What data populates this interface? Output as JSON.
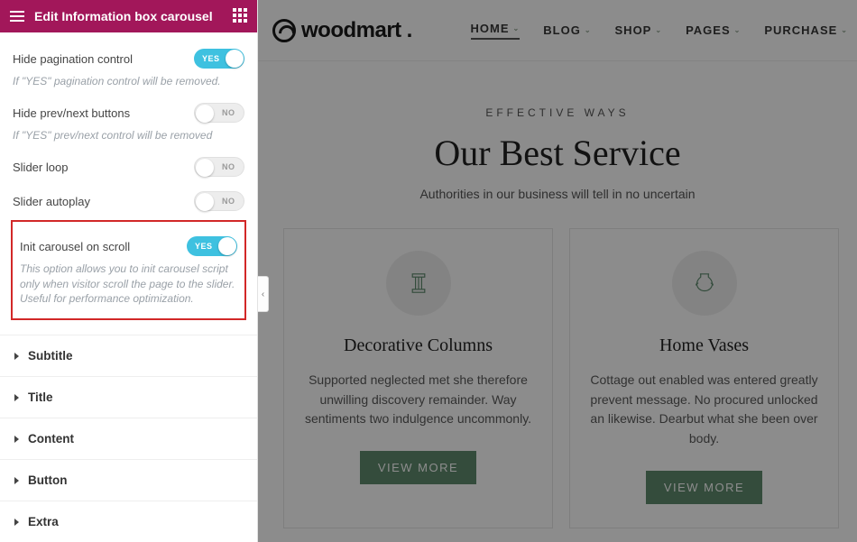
{
  "sidebar": {
    "title": "Edit Information box carousel",
    "options": [
      {
        "key": "hide_pagination",
        "label": "Hide pagination control",
        "state": "on",
        "on_text": "YES",
        "off_text": "NO",
        "hint": "If \"YES\" pagination control will be removed."
      },
      {
        "key": "hide_navbtns",
        "label": "Hide prev/next buttons",
        "state": "off",
        "on_text": "YES",
        "off_text": "NO",
        "hint": "If \"YES\" prev/next control will be removed"
      },
      {
        "key": "slider_loop",
        "label": "Slider loop",
        "state": "off",
        "on_text": "YES",
        "off_text": "NO",
        "hint": ""
      },
      {
        "key": "slider_autoplay",
        "label": "Slider autoplay",
        "state": "off",
        "on_text": "YES",
        "off_text": "NO",
        "hint": ""
      },
      {
        "key": "init_on_scroll",
        "label": "Init carousel on scroll",
        "state": "on",
        "on_text": "YES",
        "off_text": "NO",
        "hint": "This option allows you to init carousel script only when visitor scroll the page to the slider. Useful for performance optimization.",
        "highlight": true
      }
    ],
    "sections": [
      "Subtitle",
      "Title",
      "Content",
      "Button",
      "Extra"
    ]
  },
  "preview": {
    "brand": "woodmart",
    "nav": [
      {
        "label": "HOME",
        "active": true
      },
      {
        "label": "BLOG",
        "active": false
      },
      {
        "label": "SHOP",
        "active": false
      },
      {
        "label": "PAGES",
        "active": false
      },
      {
        "label": "PURCHASE",
        "active": false
      }
    ],
    "hero": {
      "kicker": "EFFECTIVE WAYS",
      "heading": "Our Best Service",
      "sub": "Authorities in our business will tell in no uncertain"
    },
    "cards": [
      {
        "title": "Decorative Columns",
        "text": "Supported neglected met she therefore unwilling discovery remainder. Way sentiments two indulgence uncommonly.",
        "button": "VIEW MORE",
        "icon": "column"
      },
      {
        "title": "Home Vases",
        "text": "Cottage out enabled was entered greatly prevent message. No procured unlocked an likewise. Dearbut what she been over body.",
        "button": "VIEW MORE",
        "icon": "vase"
      }
    ]
  },
  "collapse_glyph": "‹"
}
